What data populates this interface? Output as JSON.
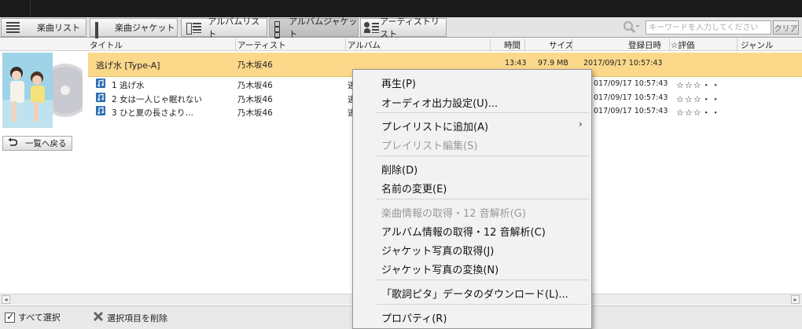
{
  "tabs": [
    {
      "label": "楽曲リスト"
    },
    {
      "label": "楽曲ジャケット"
    },
    {
      "label": "アルバムリスト"
    },
    {
      "label": "アルバムジャケット"
    },
    {
      "label": "アーティストリスト"
    }
  ],
  "search": {
    "placeholder": "キーワードを入力してください",
    "clear_label": "クリア"
  },
  "columns": {
    "title": "タイトル",
    "artist": "アーティスト",
    "album": "アルバム",
    "time": "時間",
    "size": "サイズ",
    "date": "登録日時",
    "rating": "☆評価",
    "genre": "ジャンル"
  },
  "album_row": {
    "title": "逃げ水 [Type-A]",
    "artist": "乃木坂46",
    "time": "13:43",
    "size": "97.9 MB",
    "date": "2017/09/17 10:57:43"
  },
  "tracks": [
    {
      "title": "1 逃げ水",
      "artist": "乃木坂46",
      "album": "逃",
      "date": "017/09/17 10:57:43",
      "rating": "☆☆☆・・"
    },
    {
      "title": "2 女は一人じゃ眠れない",
      "artist": "乃木坂46",
      "album": "逃",
      "date": "017/09/17 10:57:43",
      "rating": "☆☆☆・・"
    },
    {
      "title": "3 ひと夏の長さより…",
      "artist": "乃木坂46",
      "album": "逃",
      "date": "017/09/17 10:57:43",
      "rating": "☆☆☆・・"
    }
  ],
  "back_button": {
    "label": "一覧へ戻る"
  },
  "footer": {
    "select_all": "すべて選択",
    "delete_selected": "選択項目を削除"
  },
  "context_menu": {
    "play": "再生(P)",
    "audio_output": "オーディオ出力設定(U)...",
    "add_to_playlist": "プレイリストに追加(A)",
    "edit_playlist": "プレイリスト編集(S)",
    "delete": "削除(D)",
    "rename": "名前の変更(E)",
    "get_track_info": "楽曲情報の取得・12 音解析(G)",
    "get_album_info": "アルバム情報の取得・12 音解析(C)",
    "get_jacket": "ジャケット写真の取得(J)",
    "change_jacket": "ジャケット写真の変換(N)",
    "download_lyrics": "「歌詞ピタ」データのダウンロード(L)...",
    "properties": "プロパティ(R)",
    "submenu_arrow": "›"
  },
  "colors": {
    "selected_row": "#fbd88a",
    "menu_bg": "#f2f2f2",
    "disabled_text": "#9a9a9a",
    "track_icon": "#2f6fb3"
  }
}
